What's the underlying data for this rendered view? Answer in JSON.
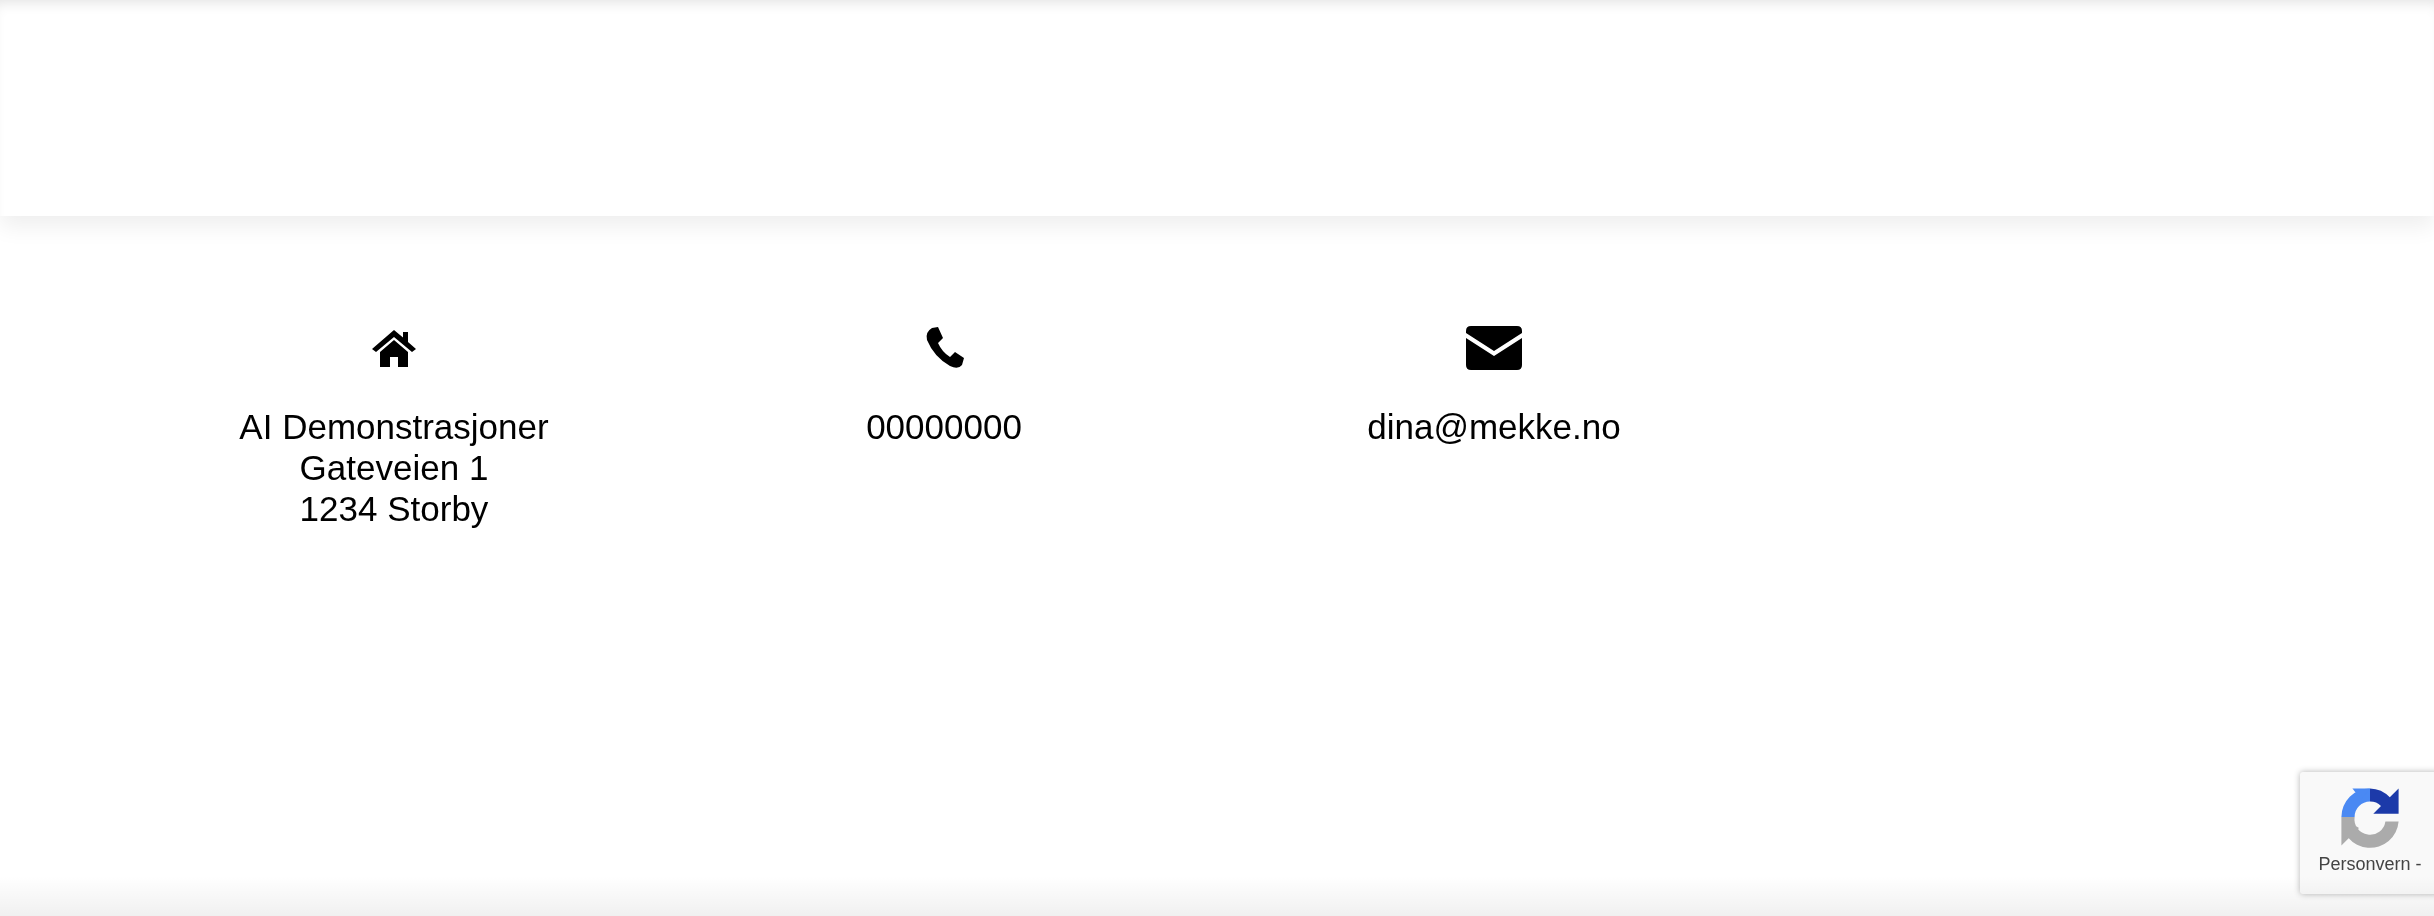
{
  "contacts": [
    {
      "kind": "address",
      "lines": [
        "AI Demonstrasjoner",
        "Gateveien 1",
        "1234 Storby"
      ]
    },
    {
      "kind": "phone",
      "lines": [
        "00000000"
      ]
    },
    {
      "kind": "email",
      "lines": [
        "dina@mekke.no"
      ]
    }
  ],
  "recaptcha_badge": {
    "label": "Personvern -"
  }
}
